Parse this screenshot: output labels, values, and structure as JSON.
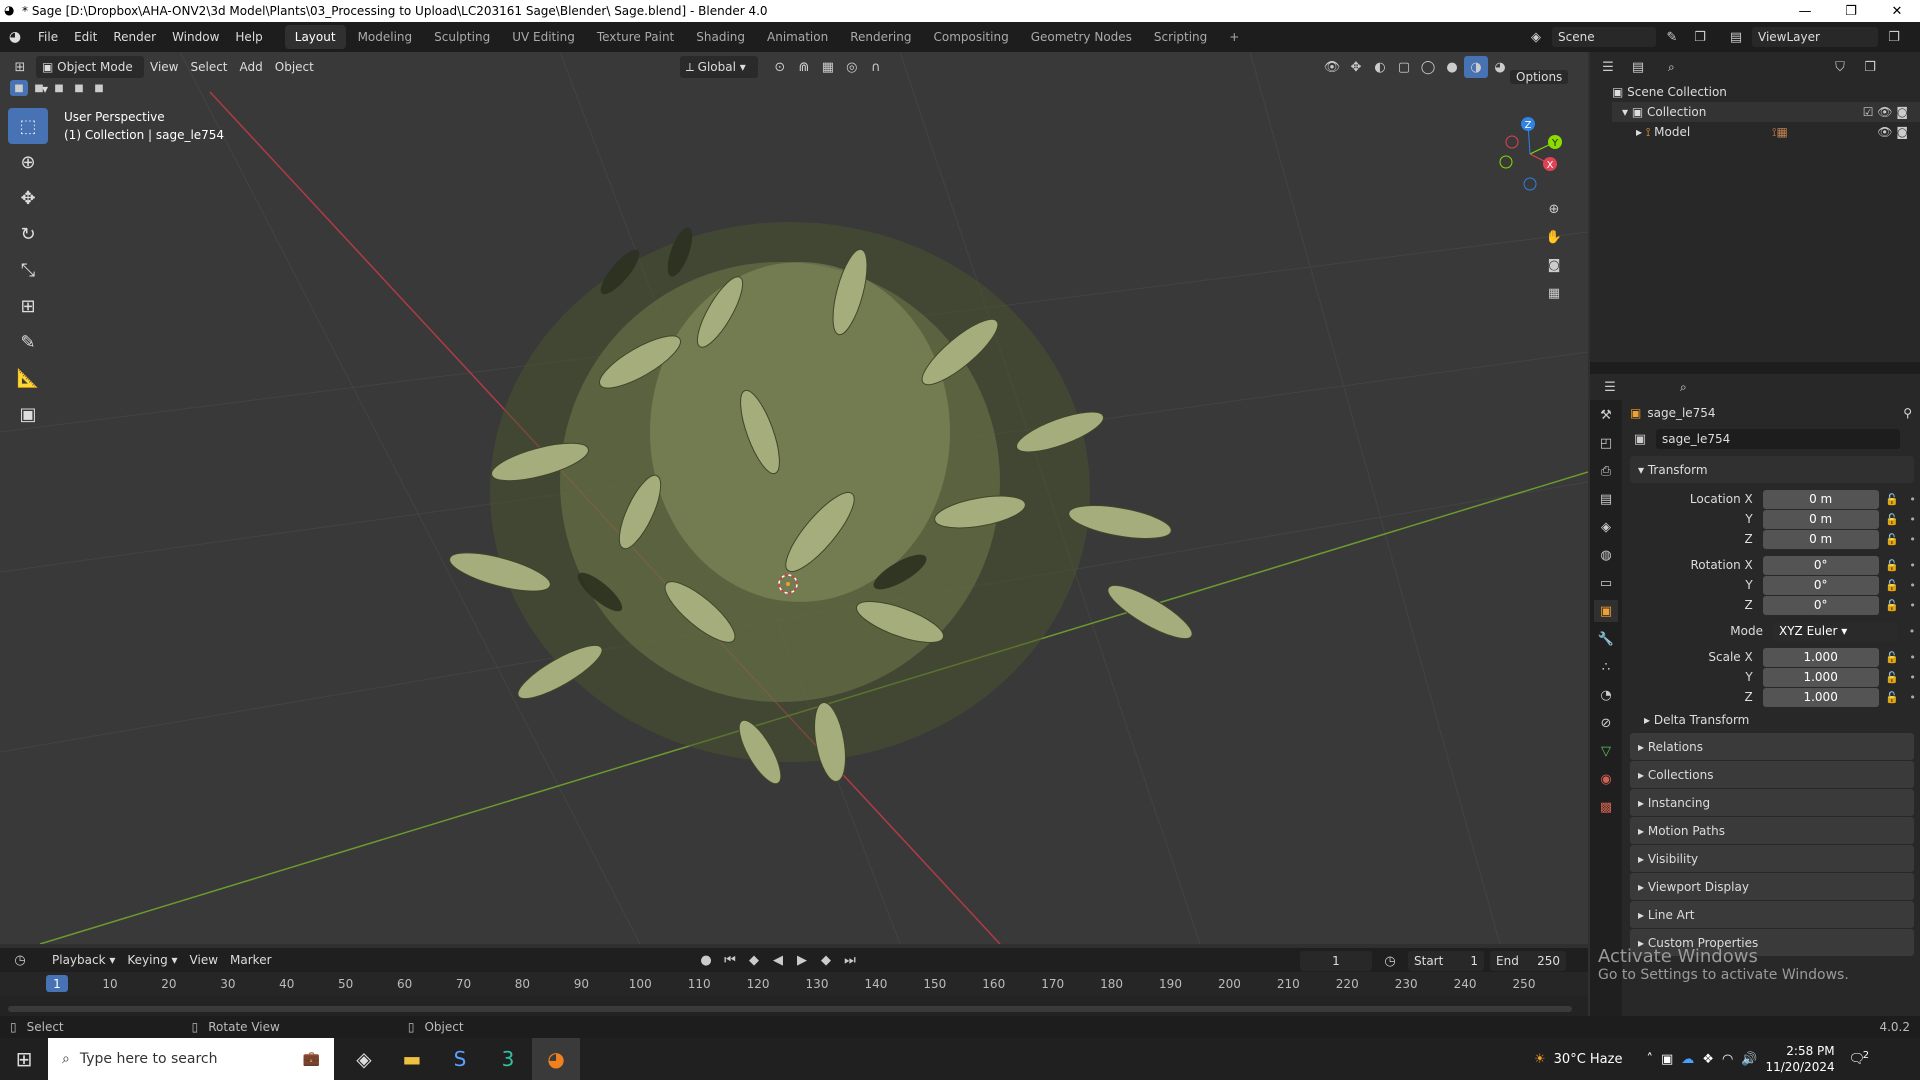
{
  "window": {
    "title": "* Sage [D:\\Dropbox\\AHA-ONV2\\3d Model\\Plants\\03_Processing to Upload\\LC203161 Sage\\Blender\\ Sage.blend] - Blender 4.0"
  },
  "menu": [
    "File",
    "Edit",
    "Render",
    "Window",
    "Help"
  ],
  "workspaces": [
    "Layout",
    "Modeling",
    "Sculpting",
    "UV Editing",
    "Texture Paint",
    "Shading",
    "Animation",
    "Rendering",
    "Compositing",
    "Geometry Nodes",
    "Scripting"
  ],
  "scene": {
    "name": "Scene",
    "view_layer": "ViewLayer"
  },
  "viewport": {
    "mode": "Object Mode",
    "menus": [
      "View",
      "Select",
      "Add",
      "Object"
    ],
    "orientation": "Global",
    "options": "Options",
    "overlay_title": "User Perspective",
    "overlay_sub": "(1) Collection | sage_le754",
    "gizmo_x": "X",
    "gizmo_y": "Y",
    "gizmo_z": "Z"
  },
  "outliner": {
    "root": "Scene Collection",
    "collection": "Collection",
    "model": "Model"
  },
  "properties": {
    "object_name": "sage_le754",
    "data_name": "sage_le754",
    "transform": "Transform",
    "location": {
      "label": "Location X",
      "x": "0 m",
      "y": "0 m",
      "z": "0 m"
    },
    "rotation": {
      "label": "Rotation X",
      "x": "0°",
      "y": "0°",
      "z": "0°"
    },
    "mode_label": "Mode",
    "mode_value": "XYZ Euler",
    "scale": {
      "label": "Scale X",
      "x": "1.000",
      "y": "1.000",
      "z": "1.000"
    },
    "axis_y": "Y",
    "axis_z": "Z",
    "delta": "Delta Transform",
    "panels": [
      "Relations",
      "Collections",
      "Instancing",
      "Motion Paths",
      "Visibility",
      "Viewport Display",
      "Line Art",
      "Custom Properties"
    ]
  },
  "timeline": {
    "menus": [
      "Playback",
      "Keying",
      "View",
      "Marker"
    ],
    "current": "1",
    "start_label": "Start",
    "start": "1",
    "end_label": "End",
    "end": "250",
    "ticks": [
      "1",
      "10",
      "20",
      "30",
      "40",
      "50",
      "60",
      "70",
      "80",
      "90",
      "100",
      "110",
      "120",
      "130",
      "140",
      "150",
      "160",
      "170",
      "180",
      "190",
      "200",
      "210",
      "220",
      "230",
      "240",
      "250"
    ]
  },
  "status": {
    "select": "Select",
    "rotate": "Rotate View",
    "object": "Object",
    "version": "4.0.2"
  },
  "watermark": {
    "line1": "Activate Windows",
    "line2": "Go to Settings to activate Windows."
  },
  "taskbar": {
    "search": "Type here to search",
    "weather": "30°C  Haze",
    "time": "2:58 PM",
    "date": "11/20/2024",
    "notif": "2"
  },
  "colors": {
    "accent": "#4772b3",
    "x_axis": "#b03a48",
    "y_axis": "#6d9a2e"
  }
}
